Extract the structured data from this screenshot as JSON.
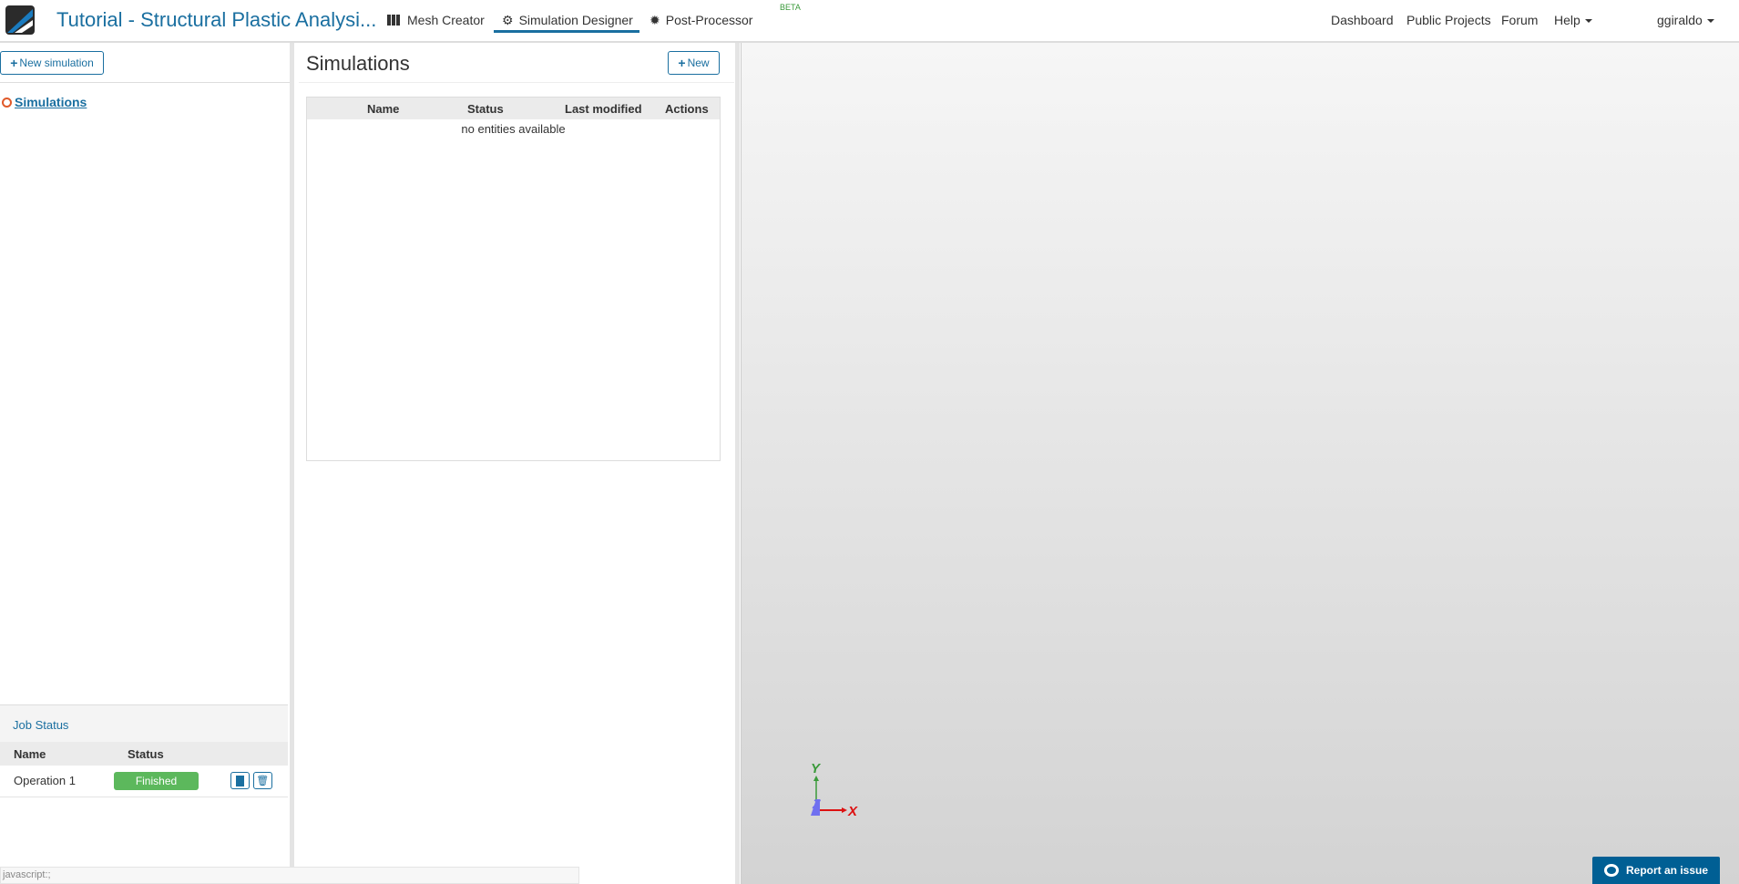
{
  "header": {
    "project_title": "Tutorial - Structural Plastic Analysi...",
    "tabs": [
      {
        "label": "Mesh Creator",
        "icon": "grid-icon"
      },
      {
        "label": "Simulation Designer",
        "icon": "gears-icon",
        "active": true
      },
      {
        "label": "Post-Processor",
        "icon": "gear-icon",
        "badge": "BETA"
      }
    ],
    "right_links": [
      "Dashboard",
      "Public Projects",
      "Forum",
      "Help"
    ],
    "user": "ggiraldo"
  },
  "left": {
    "new_button": "New simulation",
    "tree_item": "Simulations"
  },
  "middle": {
    "title": "Simulations",
    "new_button": "New",
    "columns": [
      "Name",
      "Status",
      "Last modified",
      "Actions"
    ],
    "empty": "no entities available"
  },
  "jobs": {
    "title": "Job Status",
    "columns": [
      "Name",
      "Status"
    ],
    "rows": [
      {
        "name": "Operation 1",
        "status": "Finished"
      }
    ]
  },
  "viewer": {
    "axes": {
      "x": "X",
      "y": "Y",
      "z": "Z"
    },
    "report": "Report an issue"
  },
  "statusbar": "javascript:;",
  "colors": {
    "accent": "#1a6fa0",
    "success": "#5cb85c",
    "report": "#005f94"
  }
}
